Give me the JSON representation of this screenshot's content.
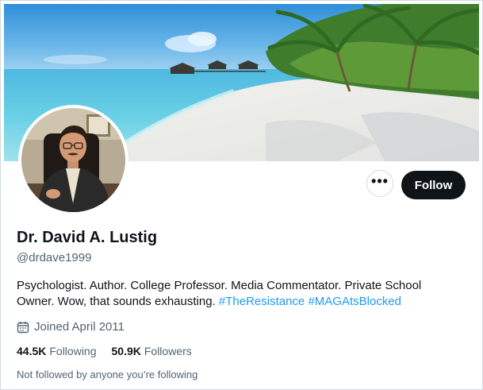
{
  "profile": {
    "display_name": "Dr. David A. Lustig",
    "handle": "@drdave1999",
    "bio_text": "Psychologist. Author. College Professor. Media Commentator. Private School Owner. Wow, that sounds exhausting. ",
    "hashtags": [
      "#TheResistance",
      "#MAGAtsBlocked"
    ],
    "joined": "Joined April 2011",
    "following_count": "44.5K",
    "following_label": "Following",
    "followers_count": "50.9K",
    "followers_label": "Followers",
    "not_followed_text": "Not followed by anyone you’re following"
  },
  "actions": {
    "more_label": "•••",
    "follow_label": "Follow"
  },
  "icons": {
    "calendar": "calendar-icon",
    "more": "more-options-icon"
  },
  "colors": {
    "accent": "#1d9bf0",
    "follow_bg": "#0f1419",
    "secondary_text": "#536471"
  }
}
